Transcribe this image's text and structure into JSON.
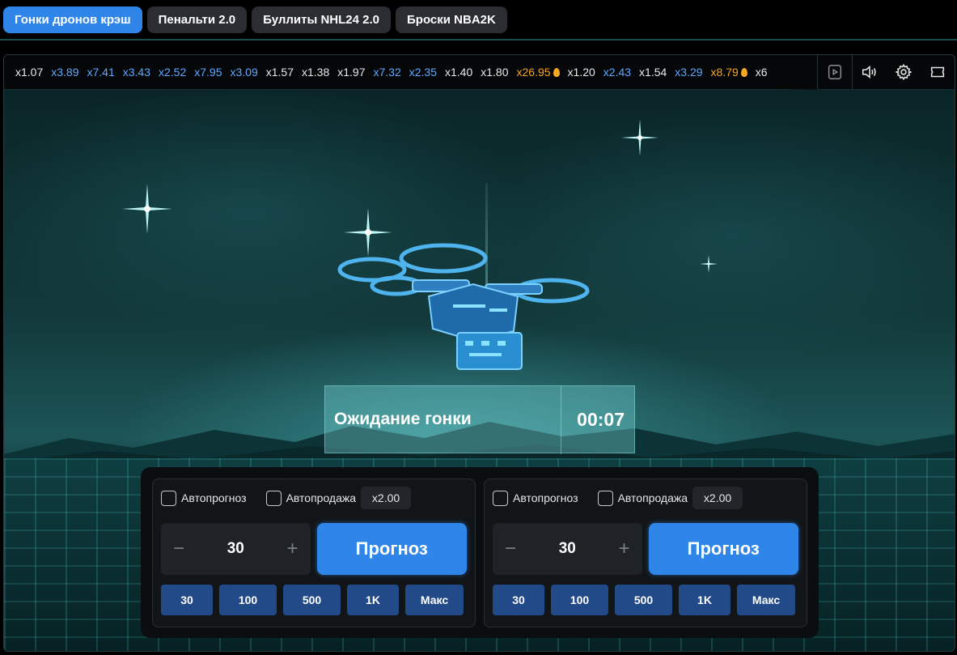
{
  "tabs": [
    {
      "label": "Гонки дронов крэш",
      "active": true
    },
    {
      "label": "Пенальти 2.0",
      "active": false
    },
    {
      "label": "Буллиты NHL24 2.0",
      "active": false
    },
    {
      "label": "Броски NBA2K",
      "active": false
    }
  ],
  "history": [
    {
      "value": "x1.07",
      "color": "white"
    },
    {
      "value": "x3.89",
      "color": "blue"
    },
    {
      "value": "x7.41",
      "color": "blue"
    },
    {
      "value": "x3.43",
      "color": "blue"
    },
    {
      "value": "x2.52",
      "color": "blue"
    },
    {
      "value": "x7.95",
      "color": "blue"
    },
    {
      "value": "x3.09",
      "color": "blue"
    },
    {
      "value": "x1.57",
      "color": "white"
    },
    {
      "value": "x1.38",
      "color": "white"
    },
    {
      "value": "x1.97",
      "color": "white"
    },
    {
      "value": "x7.32",
      "color": "blue"
    },
    {
      "value": "x2.35",
      "color": "blue"
    },
    {
      "value": "x1.40",
      "color": "white"
    },
    {
      "value": "x1.80",
      "color": "white"
    },
    {
      "value": "x26.95",
      "color": "orange",
      "flame": true
    },
    {
      "value": "x1.20",
      "color": "white"
    },
    {
      "value": "x2.43",
      "color": "blue"
    },
    {
      "value": "x1.54",
      "color": "white"
    },
    {
      "value": "x3.29",
      "color": "blue"
    },
    {
      "value": "x8.79",
      "color": "orange",
      "flame": true
    },
    {
      "value": "x6",
      "color": "white"
    }
  ],
  "controls": [
    "play-icon",
    "sound-icon",
    "settings-icon",
    "ticket-icon"
  ],
  "status": {
    "text": "Ожидание гонки",
    "time": "00:07"
  },
  "bets": [
    {
      "auto_predict_label": "Автопрогноз",
      "auto_sell_label": "Автопродажа",
      "multiplier": "x2.00",
      "minus": "−",
      "plus": "+",
      "amount": "30",
      "predict_label": "Прогноз",
      "quick": [
        "30",
        "100",
        "500",
        "1K",
        "Макс"
      ]
    },
    {
      "auto_predict_label": "Автопрогноз",
      "auto_sell_label": "Автопродажа",
      "multiplier": "x2.00",
      "minus": "−",
      "plus": "+",
      "amount": "30",
      "predict_label": "Прогноз",
      "quick": [
        "30",
        "100",
        "500",
        "1K",
        "Макс"
      ]
    }
  ],
  "colors": {
    "accent": "#2f86e8",
    "quick_button": "#224a88",
    "coef_blue": "#5fa8ff",
    "coef_orange": "#f5a623"
  }
}
